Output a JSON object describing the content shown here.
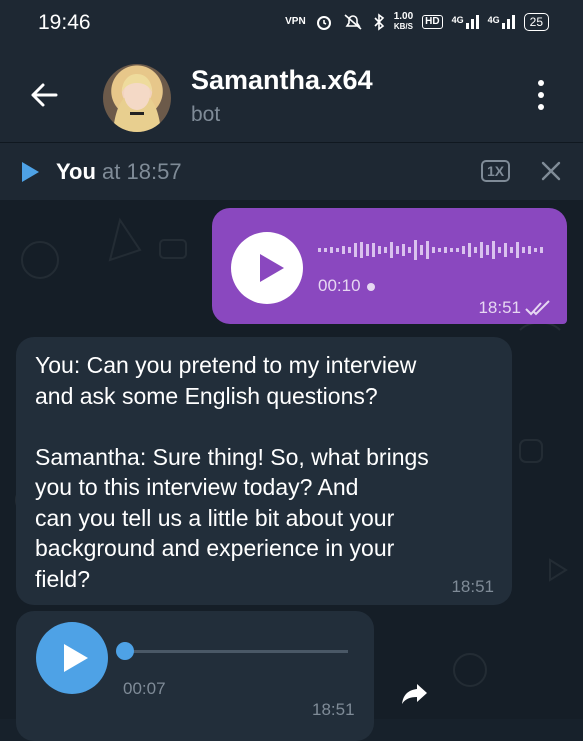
{
  "status_bar": {
    "time": "19:46",
    "vpn": "VPN",
    "speed_value": "1.00",
    "speed_unit": "KB/S",
    "hd": "HD",
    "net1": "4G",
    "net2": "4G",
    "battery": "25"
  },
  "header": {
    "title": "Samantha.x64",
    "subtitle": "bot"
  },
  "player_bar": {
    "sender": "You",
    "at_time": "at 18:57",
    "speed": "1X"
  },
  "messages": {
    "outgoing_voice": {
      "duration": "00:10",
      "time": "18:51"
    },
    "incoming_text": {
      "text": "You: Can you pretend to my interview\nand ask some English questions?\n\nSamantha: Sure thing! So, what brings\nyou to this interview today? And\ncan you tell us a little bit about your\nbackground and experience in your\nfield?",
      "time": "18:51"
    },
    "incoming_voice": {
      "duration": "00:07",
      "time": "18:51",
      "progress": 0
    }
  },
  "colors": {
    "accent": "#4ea2e6",
    "outgoing_bubble": "#8a48bf",
    "incoming_bubble": "#222e3a",
    "background": "#151e27",
    "header": "#1e2833"
  }
}
